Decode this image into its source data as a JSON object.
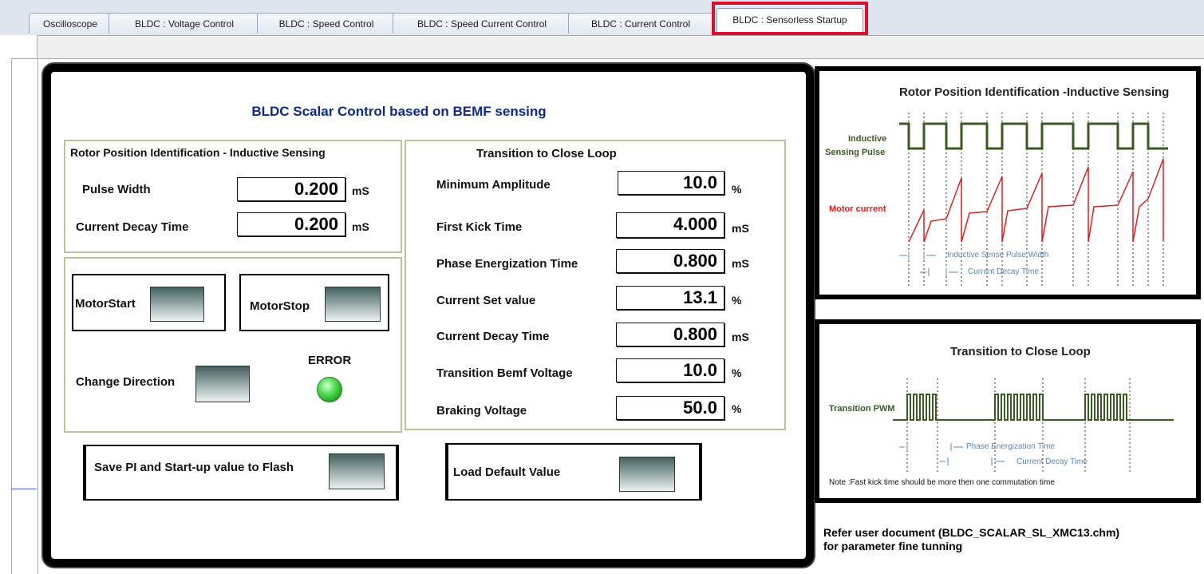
{
  "tabs": [
    {
      "label": "Oscilloscope"
    },
    {
      "label": "BLDC : Voltage Control"
    },
    {
      "label": "BLDC : Speed Control"
    },
    {
      "label": "BLDC : Speed Current Control"
    },
    {
      "label": "BLDC : Current  Control"
    },
    {
      "label": "BLDC : Sensorless Startup",
      "active": true
    }
  ],
  "panel": {
    "title": "BLDC Scalar Control based on BEMF sensing",
    "rotor": {
      "heading": "Rotor Position Identification - Inductive Sensing",
      "fields": [
        {
          "label": "Pulse Width",
          "value": "0.200",
          "unit": "mS"
        },
        {
          "label": "Current Decay Time",
          "value": "0.200",
          "unit": "mS"
        }
      ]
    },
    "controls": {
      "motor_start": "MotorStart",
      "motor_stop": "MotorStop",
      "change_direction": "Change Direction",
      "error": "ERROR",
      "error_led_color": "#3fd33f"
    },
    "transition": {
      "heading": "Transition to Close Loop",
      "fields": [
        {
          "label": "Minimum Amplitude",
          "value": "10.0",
          "unit": "%"
        },
        {
          "label": "First Kick Time",
          "value": "4.000",
          "unit": "mS"
        },
        {
          "label": "Phase Energization Time",
          "value": "0.800",
          "unit": "mS"
        },
        {
          "label": "Current Set value",
          "value": "13.1",
          "unit": "%"
        },
        {
          "label": "Current  Decay Time",
          "value": "0.800",
          "unit": "mS"
        },
        {
          "label": "Transition Bemf Voltage",
          "value": "10.0",
          "unit": "%"
        },
        {
          "label": "Braking Voltage",
          "value": "50.0",
          "unit": "%"
        }
      ]
    },
    "save_flash": "Save PI and Start-up value to Flash",
    "load_default": "Load Default Value"
  },
  "diagram1": {
    "title": "Rotor Position Identification -Inductive Sensing",
    "pulse_label_1": "Inductive",
    "pulse_label_2": "Sensing Pulse",
    "current_label": "Motor current",
    "ann1": "Inductive Sense Pulse Width",
    "ann2": "Current Decay Time",
    "pulse_color": "#3a5a22",
    "current_color": "#d42424",
    "annotation_color": "#5b86b8"
  },
  "diagram2": {
    "title": "Transition to Close Loop",
    "pwm_label": "Transition PWM",
    "ann1": "Phase Energization Time",
    "ann2": "Current Decay Time",
    "note": "Note :Fast kick time should be more then one commutation time"
  },
  "refer": {
    "line1": "Refer user document (BLDC_SCALAR_SL_XMC13.chm)",
    "line2": "for parameter fine tunning"
  }
}
